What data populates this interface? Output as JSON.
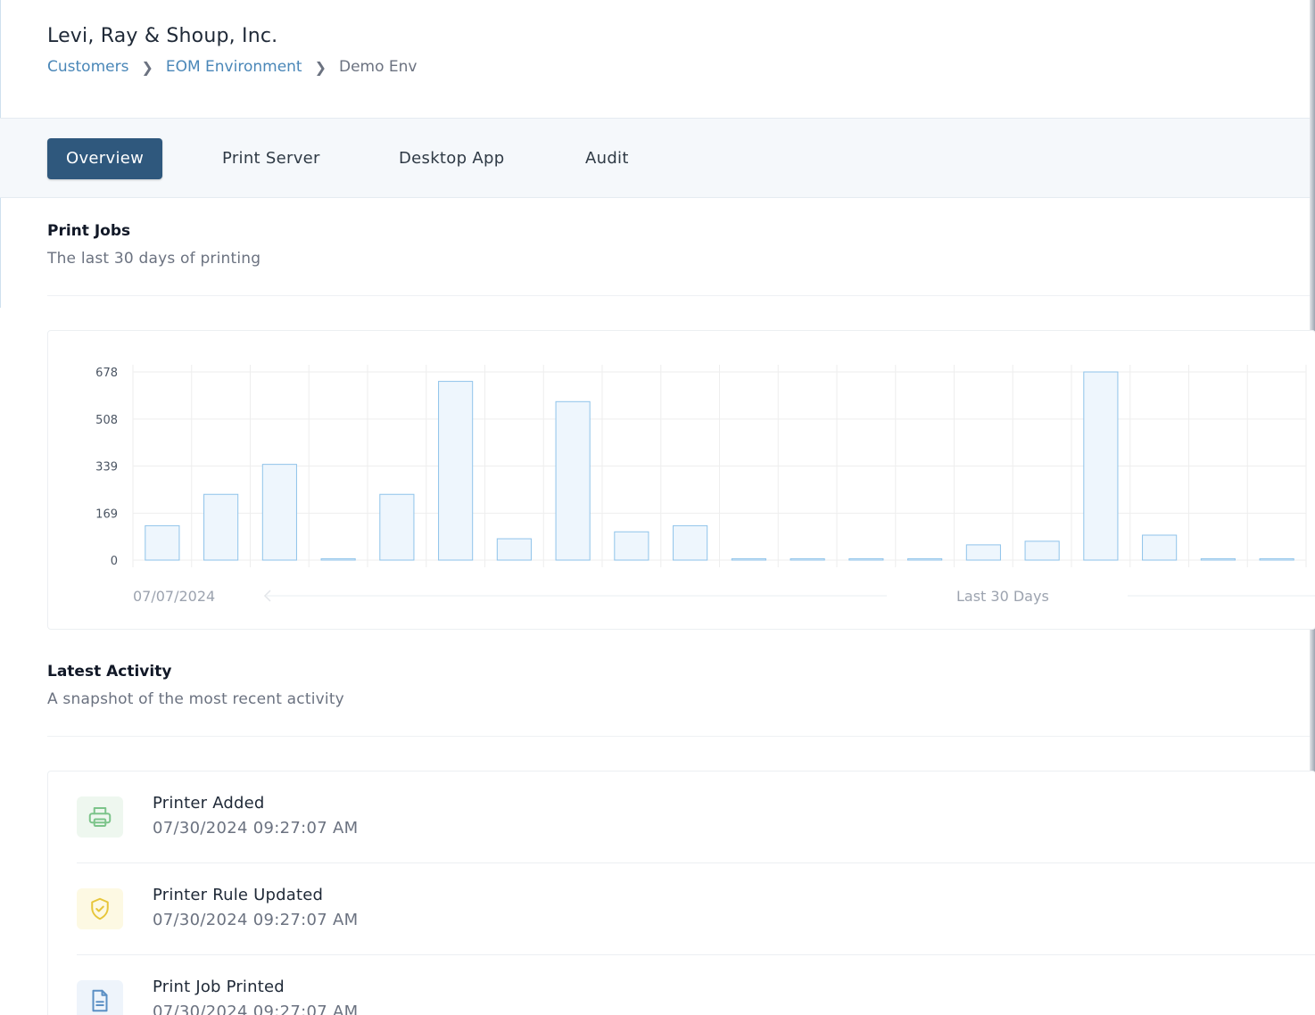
{
  "header": {
    "org_title": "Levi, Ray & Shoup, Inc.",
    "breadcrumb": [
      {
        "label": "Customers",
        "link": true
      },
      {
        "label": "EOM Environment",
        "link": true
      },
      {
        "label": "Demo Env",
        "link": false
      }
    ]
  },
  "tabs": [
    {
      "label": "Overview",
      "active": true
    },
    {
      "label": "Print Server",
      "active": false
    },
    {
      "label": "Desktop App",
      "active": false
    },
    {
      "label": "Audit",
      "active": false
    }
  ],
  "print_jobs": {
    "title": "Print Jobs",
    "subtitle": "The last 30 days of printing"
  },
  "chart_data": {
    "type": "bar",
    "yticks": [
      "678",
      "508",
      "339",
      "169",
      "0"
    ],
    "ylim": [
      0,
      678
    ],
    "values": [
      124,
      237,
      345,
      5,
      237,
      644,
      77,
      571,
      102,
      124,
      5,
      5,
      5,
      5,
      55,
      68,
      678,
      90,
      5,
      5
    ],
    "x_start_label": "07/07/2024",
    "range_label": "Last 30 Days",
    "grid": true,
    "colors": {
      "bar_fill": "#eef6fd",
      "bar_stroke": "#8fc3ea",
      "grid": "#eeeeee"
    }
  },
  "activity": {
    "title": "Latest Activity",
    "subtitle": "A snapshot of the most recent activity",
    "items": [
      {
        "name": "Printer Added",
        "time": "07/30/2024 09:27:07 AM",
        "icon": "printer-icon",
        "bg": "#eef7ef",
        "color": "#7cc48a"
      },
      {
        "name": "Printer Rule Updated",
        "time": "07/30/2024 09:27:07 AM",
        "icon": "shield-check-icon",
        "bg": "#fdf9e3",
        "color": "#e7c63a"
      },
      {
        "name": "Print Job Printed",
        "time": "07/30/2024 09:27:07 AM",
        "icon": "document-icon",
        "bg": "#eef4fb",
        "color": "#5b8fc4"
      }
    ]
  }
}
